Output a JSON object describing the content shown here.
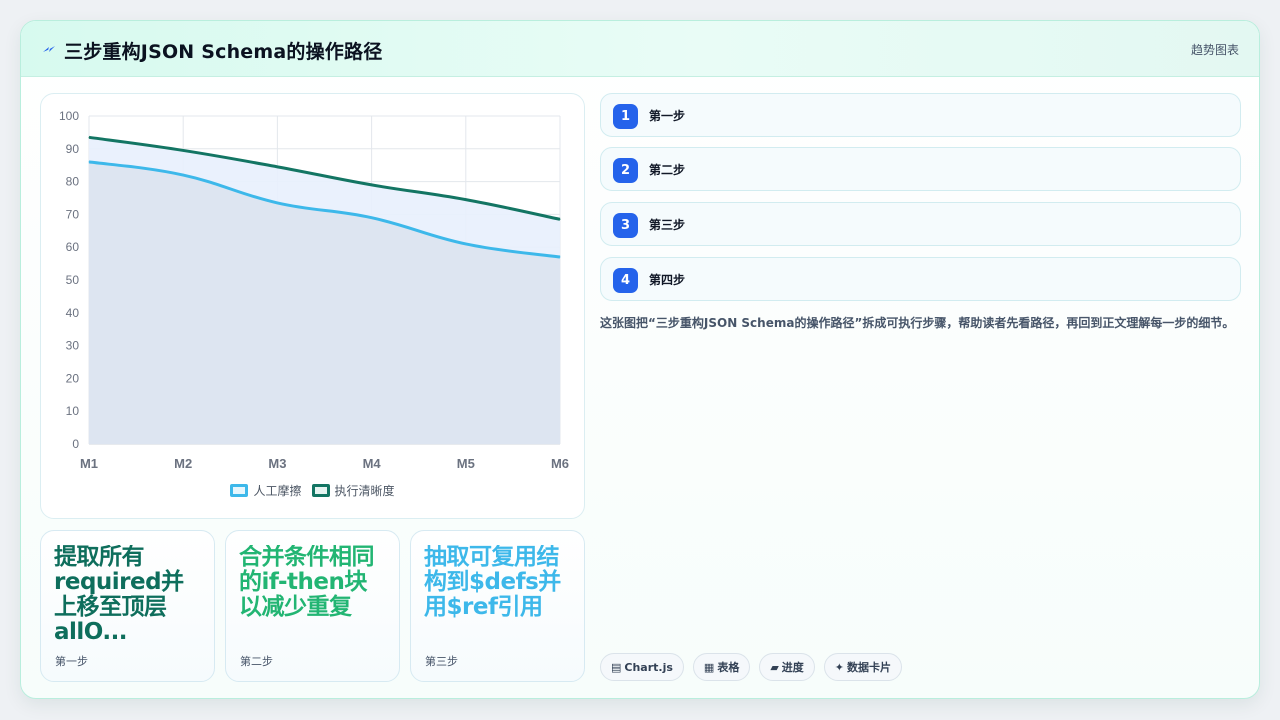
{
  "header": {
    "title": "三步重构JSON Schema的操作路径",
    "tag": "趋势图表"
  },
  "chart_data": {
    "type": "line",
    "categories": [
      "M1",
      "M2",
      "M3",
      "M4",
      "M5",
      "M6"
    ],
    "ylim": [
      0,
      100
    ],
    "yticks": [
      0,
      10,
      20,
      30,
      40,
      50,
      60,
      70,
      80,
      90,
      100
    ],
    "series": [
      {
        "name": "人工摩擦",
        "values": [
          86,
          82,
          73.5,
          69,
          61,
          57
        ],
        "color": "#3db8ea",
        "fill": "#dbe3ef"
      },
      {
        "name": "执行清晰度",
        "values": [
          93.5,
          89.5,
          84.5,
          79,
          74.5,
          68.5
        ],
        "color": "#137563",
        "fill": "#e8f0fd"
      }
    ],
    "grid": true,
    "legend": "bottom"
  },
  "stats": [
    {
      "value": "提取所有required并上移至顶层allO...",
      "label": "第一步",
      "color": "#0e6e5c"
    },
    {
      "value": "合并条件相同的if-then块以减少重复",
      "label": "第二步",
      "color": "#22b573"
    },
    {
      "value": "抽取可复用结构到$defs并用$ref引用",
      "label": "第三步",
      "color": "#3db8ea"
    }
  ],
  "steps": [
    {
      "num": "1",
      "label": "第一步"
    },
    {
      "num": "2",
      "label": "第二步"
    },
    {
      "num": "3",
      "label": "第三步"
    },
    {
      "num": "4",
      "label": "第四步"
    }
  ],
  "description": "这张图把“三步重构JSON Schema的操作路径”拆成可执行步骤，帮助读者先看路径，再回到正文理解每一步的细节。",
  "chips": [
    {
      "icon": "▤",
      "label": "Chart.js"
    },
    {
      "icon": "▦",
      "label": "表格"
    },
    {
      "icon": "▰",
      "label": "进度"
    },
    {
      "icon": "✦",
      "label": "数据卡片"
    }
  ]
}
